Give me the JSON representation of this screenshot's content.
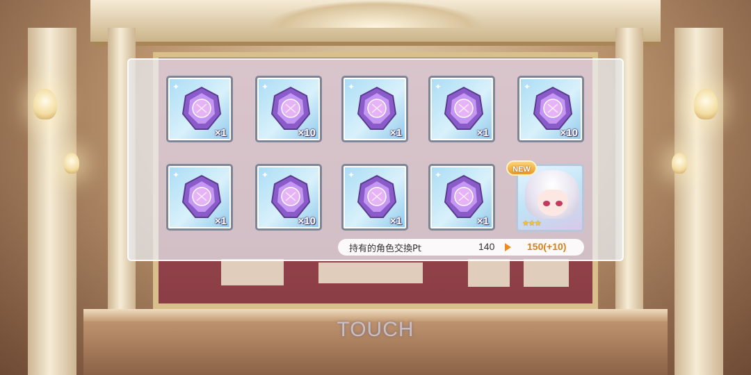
{
  "items": [
    {
      "name": "memory-piece",
      "qty": "×1"
    },
    {
      "name": "memory-piece",
      "qty": "×10"
    },
    {
      "name": "memory-piece",
      "qty": "×1"
    },
    {
      "name": "memory-piece",
      "qty": "×1"
    },
    {
      "name": "memory-piece",
      "qty": "×10"
    },
    {
      "name": "memory-piece",
      "qty": "×1"
    },
    {
      "name": "memory-piece",
      "qty": "×10"
    },
    {
      "name": "memory-piece",
      "qty": "×1"
    },
    {
      "name": "memory-piece",
      "qty": "×1"
    }
  ],
  "character": {
    "badge": "NEW",
    "stars": "★★★"
  },
  "points": {
    "label": "持有的角色交換Pt",
    "before": "140",
    "after": "150(+10)"
  },
  "touch_prompt": "TOUCH",
  "colors": {
    "panel": "#ecf0f6",
    "item_frame": "#7c8697",
    "gem": "#9a6cd6",
    "accent": "#f08a1c"
  }
}
